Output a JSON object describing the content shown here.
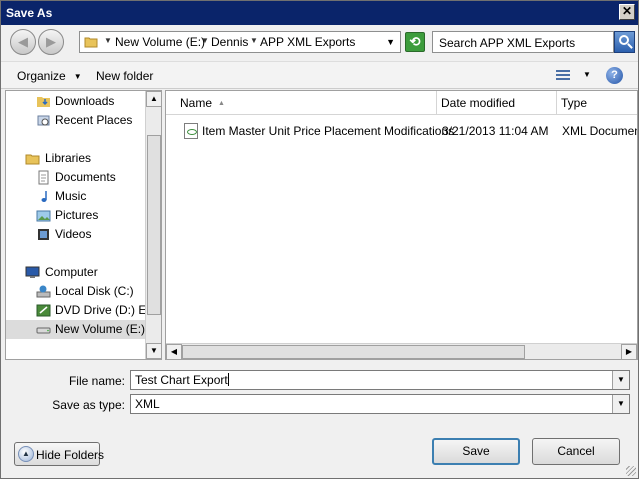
{
  "window": {
    "title": "Save As",
    "close_glyph": "✕"
  },
  "address_bar": {
    "segments": [
      "New Volume (E:)",
      "Dennis",
      "APP XML Exports"
    ],
    "search_placeholder": "Search APP XML Exports"
  },
  "toolbar": {
    "organize_label": "Organize",
    "new_folder_label": "New folder",
    "help_glyph": "?"
  },
  "nav_pane": {
    "items": [
      {
        "label": "Downloads",
        "icon": "downloads-folder-icon"
      },
      {
        "label": "Recent Places",
        "icon": "recent-places-icon"
      },
      {
        "label": "Libraries",
        "icon": "libraries-icon"
      },
      {
        "label": "Documents",
        "icon": "documents-icon"
      },
      {
        "label": "Music",
        "icon": "music-icon"
      },
      {
        "label": "Pictures",
        "icon": "pictures-icon"
      },
      {
        "label": "Videos",
        "icon": "videos-icon"
      },
      {
        "label": "Computer",
        "icon": "computer-icon"
      },
      {
        "label": "Local Disk (C:)",
        "icon": "local-disk-icon"
      },
      {
        "label": "DVD Drive (D:) ENL",
        "icon": "dvd-drive-icon"
      },
      {
        "label": "New Volume (E:)",
        "icon": "drive-icon",
        "selected": true
      }
    ]
  },
  "file_list": {
    "columns": [
      "Name",
      "Date modified",
      "Type"
    ],
    "rows": [
      {
        "name": "Item Master Unit Price Placement Modifications",
        "date_modified": "3/21/2013 11:04 AM",
        "type": "XML Document",
        "icon": "xml-file-icon"
      }
    ]
  },
  "form": {
    "file_name_label": "File name:",
    "file_name_value": "Test Chart Export",
    "save_type_label": "Save as type:",
    "save_type_value": "XML"
  },
  "footer": {
    "hide_folders_label": "Hide Folders",
    "save_label": "Save",
    "cancel_label": "Cancel"
  },
  "colors": {
    "titlebar": "#0a246a",
    "selection": "#dcdcdc",
    "accent": "#3c7fb1"
  }
}
